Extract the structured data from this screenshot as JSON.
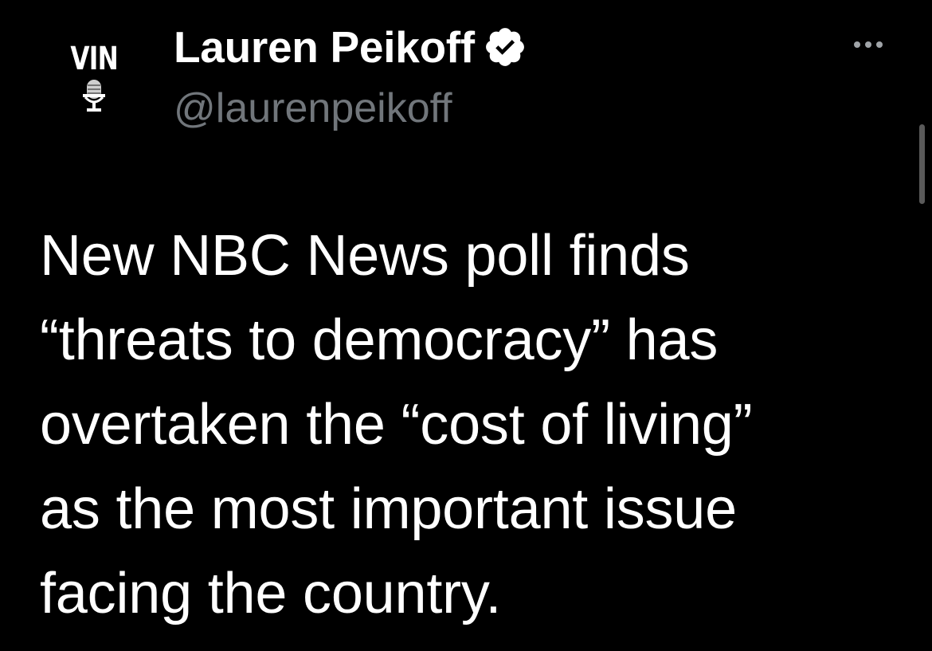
{
  "author": {
    "avatar_text": "VIN",
    "display_name": "Lauren Peikoff",
    "handle": "@laurenpeikoff",
    "verified": true
  },
  "menu": {
    "icon": "more-horizontal-icon"
  },
  "tweet": {
    "lines": [
      "New NBC News poll finds",
      "“threats to democracy” has",
      "overtaken the “cost of living”",
      "as the most important issue",
      "facing the country."
    ]
  },
  "colors": {
    "background": "#000000",
    "text_primary": "#ffffff",
    "text_secondary": "#71767b",
    "verified_badge": "#ffffff"
  }
}
